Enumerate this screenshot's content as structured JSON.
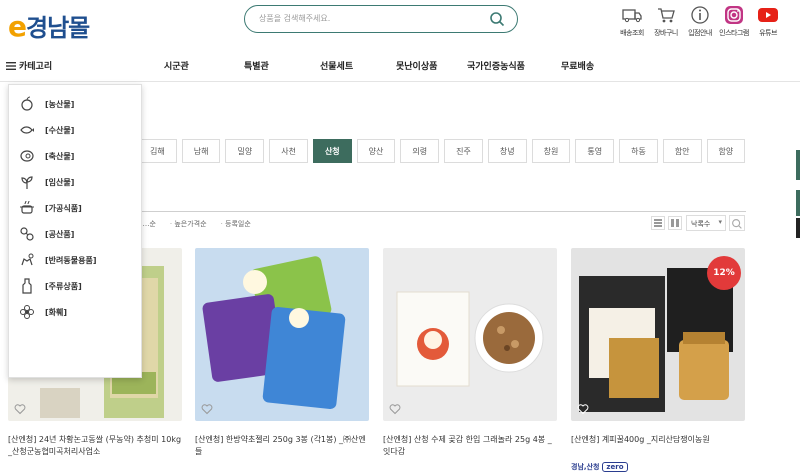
{
  "header": {
    "logo_e": "e",
    "logo_text": "경남몰",
    "search_placeholder": "상품을 검색해주세요.",
    "icons": [
      {
        "name": "truck-icon",
        "label": "배송조회"
      },
      {
        "name": "cart-icon",
        "label": "장바구니"
      },
      {
        "name": "info-icon",
        "label": "입점안내"
      },
      {
        "name": "instagram-icon",
        "label": "인스타그램"
      },
      {
        "name": "youtube-icon",
        "label": "유튜브"
      }
    ]
  },
  "nav": {
    "category_label": "카테고리",
    "items": [
      "시군관",
      "특별관",
      "선물세트",
      "못난이상품",
      "국가인증농식품",
      "무료배송"
    ]
  },
  "categories": [
    {
      "icon": "apple-icon",
      "label": "[농산물]"
    },
    {
      "icon": "fish-icon",
      "label": "[수산물]"
    },
    {
      "icon": "meat-icon",
      "label": "[축산물]"
    },
    {
      "icon": "sprout-icon",
      "label": "[임산물]"
    },
    {
      "icon": "pot-icon",
      "label": "[가공식품]"
    },
    {
      "icon": "craft-icon",
      "label": "[공산품]"
    },
    {
      "icon": "pet-icon",
      "label": "[반려동물용품]"
    },
    {
      "icon": "bottle-icon",
      "label": "[주류상품]"
    },
    {
      "icon": "flower-icon",
      "label": "[화훼]"
    }
  ],
  "regions": {
    "items": [
      "김해",
      "남해",
      "밀양",
      "사천",
      "산청",
      "양산",
      "의령",
      "진주",
      "창녕",
      "창원",
      "통영",
      "하동",
      "함안",
      "함양"
    ],
    "active": "산청"
  },
  "sort": {
    "options": [
      "…순",
      "높은가격순",
      "등록일순"
    ],
    "selected": "낙록수"
  },
  "products": [
    {
      "name": "[산엔청] 24년 차황논고동쌀 (무농약) 추청미 10kg _산청군농협미곡처리사업소",
      "tag": "",
      "badge": "",
      "colors": {
        "bg": "#f0efe9"
      }
    },
    {
      "name": "[산엔청] 한방약초젤리 250g 3봉 (각1봉) _㈜산엔들",
      "tag": "",
      "badge": "",
      "colors": {
        "bg": "#bcd4e8"
      }
    },
    {
      "name": "[산엔청] 산청 수제 곶감 한입 그래놀라 25g 4봉 _잇다감",
      "tag": "",
      "badge": "",
      "colors": {
        "bg": "#ededed"
      }
    },
    {
      "name": "[산엔청] 계피꿀400g _지리산담쟁이농원",
      "tag": "경남,산청",
      "tag_zero": "zero",
      "badge": "12%",
      "colors": {
        "bg": "#e3e3e3"
      }
    }
  ]
}
